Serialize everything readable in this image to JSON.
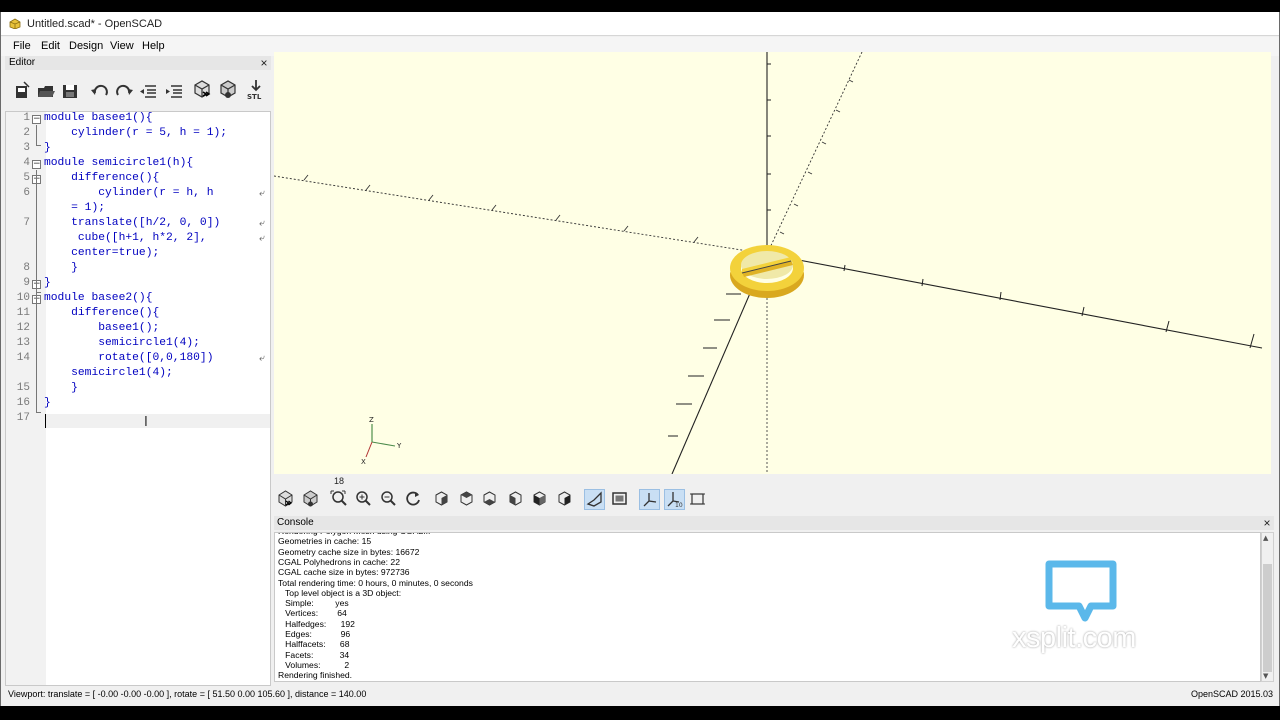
{
  "window": {
    "title": "Untitled.scad* - OpenSCAD"
  },
  "menubar": {
    "items": [
      "File",
      "Edit",
      "Design",
      "View",
      "Help"
    ]
  },
  "editor": {
    "title": "Editor",
    "toolbar": [
      "new-file",
      "open-file",
      "save",
      "undo",
      "redo",
      "unindent",
      "indent",
      "preview",
      "render",
      "export-stl"
    ],
    "lines": [
      {
        "no": "1",
        "text": "module basee1(){"
      },
      {
        "no": "2",
        "text": "    cylinder(r = 5, h = 1);"
      },
      {
        "no": "3",
        "text": "}"
      },
      {
        "no": "4",
        "text": "module semicircle1(h){"
      },
      {
        "no": "5",
        "text": "    difference(){"
      },
      {
        "no": "6",
        "text": "        cylinder(r = h, h"
      },
      {
        "no": "",
        "text": "    = 1);"
      },
      {
        "no": "7",
        "text": "    translate([h/2, 0, 0])"
      },
      {
        "no": "",
        "text": "     cube([h+1, h*2, 2],"
      },
      {
        "no": "",
        "text": "    center=true);"
      },
      {
        "no": "8",
        "text": "    }"
      },
      {
        "no": "9",
        "text": "}"
      },
      {
        "no": "10",
        "text": "module basee2(){"
      },
      {
        "no": "11",
        "text": "    difference(){"
      },
      {
        "no": "12",
        "text": "        basee1();"
      },
      {
        "no": "13",
        "text": "        semicircle1(4);"
      },
      {
        "no": "14",
        "text": "        rotate([0,0,180])"
      },
      {
        "no": "",
        "text": "    semicircle1(4);"
      },
      {
        "no": "15",
        "text": "    }"
      },
      {
        "no": "16",
        "text": "}"
      },
      {
        "no": "17",
        "text": ""
      }
    ]
  },
  "viewport": {
    "background": "#ffffe5",
    "axes_labels": {
      "z": "Z",
      "y": "Y",
      "x": "X"
    },
    "scale_label": "18",
    "model_color": "#f3d23b"
  },
  "view_toolbar": [
    "preview",
    "render",
    "view-all",
    "zoom-in",
    "zoom-out",
    "reset-view",
    "view-right",
    "view-top",
    "view-bottom",
    "view-left",
    "view-front",
    "view-back",
    "perspective",
    "orthogonal",
    "show-axes",
    "show-scale-markers",
    "show-edges"
  ],
  "console": {
    "title": "Console",
    "lines": [
      "Rendering Polygon Mesh using CGAL...",
      "Geometries in cache: 15",
      "Geometry cache size in bytes: 16672",
      "CGAL Polyhedrons in cache: 22",
      "CGAL cache size in bytes: 972736",
      "Total rendering time: 0 hours, 0 minutes, 0 seconds",
      "   Top level object is a 3D object:",
      "   Simple:         yes",
      "   Vertices:        64",
      "   Halfedges:      192",
      "   Edges:            96",
      "   Halffacets:      68",
      "   Facets:           34",
      "   Volumes:          2",
      "Rendering finished."
    ]
  },
  "watermark": {
    "text": "xsplit.com",
    "color": "#5bb8ea"
  },
  "statusbar": {
    "viewport": "Viewport: translate = [ -0.00 -0.00 -0.00 ], rotate = [ 51.50 0.00 105.60 ], distance = 140.00",
    "version": "OpenSCAD 2015.03"
  }
}
